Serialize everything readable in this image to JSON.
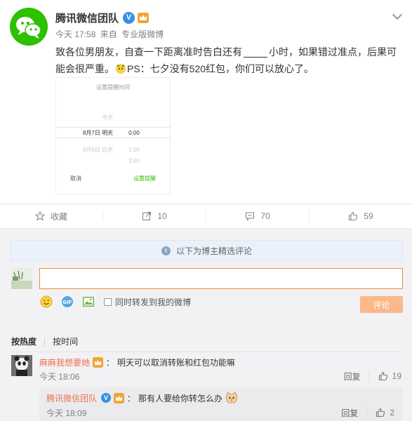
{
  "post": {
    "author": "腾讯微信团队",
    "time": "今天 17:58",
    "from_label": "来自",
    "source": "专业版微博",
    "content_before": "致各位男朋友，自查一下距离准时告白还有",
    "content_after": "小时，如果错过准点，后果可能会很严重。",
    "content_ps": "PS：七夕没有520红包，你们可以放心了。",
    "image": {
      "title": "设置提醒时间",
      "rows": [
        {
          "date": "今天",
          "time": ""
        },
        {
          "date": "8月7日 明天",
          "time": "0:00"
        },
        {
          "date": "8月8日 后天",
          "time": "1:00"
        },
        {
          "date": "",
          "time": "2:00"
        }
      ],
      "cancel": "取消",
      "confirm": "设置提醒"
    }
  },
  "actions": {
    "favorite": "收藏",
    "repost": "10",
    "comment": "70",
    "like": "59"
  },
  "comments": {
    "notice": "以下为博主精选评论",
    "input_value": "",
    "forward_label": "同时转发到我的微博",
    "submit": "评论",
    "sort_hot": "按热度",
    "sort_time": "按时间",
    "items": [
      {
        "user": "麻麻我想要她",
        "text": "明天可以取消转账和红包功能嘛",
        "time": "今天 18:06",
        "reply": "回复",
        "likes": "19"
      }
    ],
    "reply": {
      "user": "腾讯微信团队",
      "text": "那有人要给你转怎么办",
      "time": "今天 18:09",
      "reply": "回复",
      "likes": "2"
    }
  },
  "colors": {
    "wechat_green": "#2dc100",
    "username_orange": "#eb7350",
    "input_border": "#f28a38",
    "submit_disabled": "#fbb888"
  }
}
